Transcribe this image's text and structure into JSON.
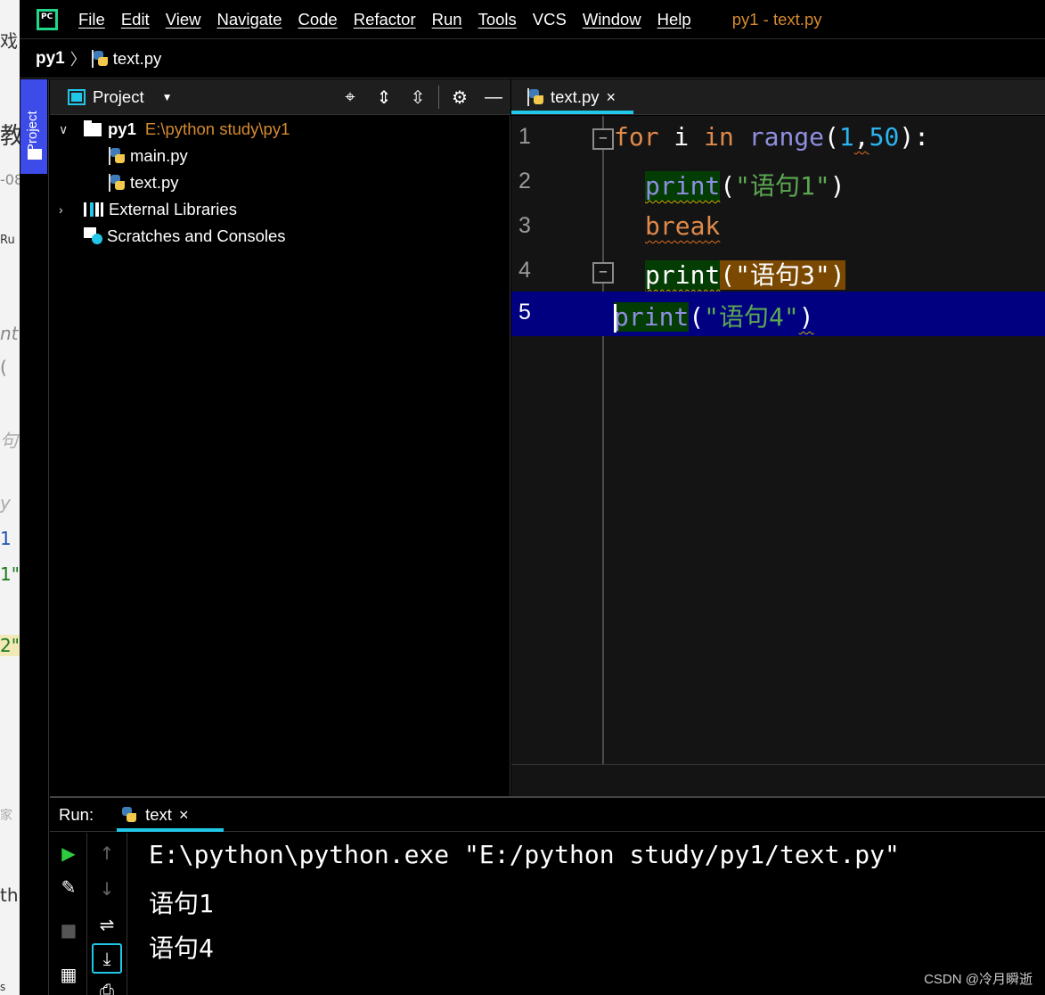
{
  "menubar": {
    "logo": "PC",
    "items": [
      {
        "label": "File",
        "underline": true
      },
      {
        "label": "Edit",
        "underline": true
      },
      {
        "label": "View",
        "underline": true
      },
      {
        "label": "Navigate",
        "underline": true
      },
      {
        "label": "Code",
        "underline": true
      },
      {
        "label": "Refactor",
        "underline": true
      },
      {
        "label": "Run",
        "underline": true
      },
      {
        "label": "Tools",
        "underline": true
      },
      {
        "label": "VCS",
        "underline": false
      },
      {
        "label": "Window",
        "underline": true
      },
      {
        "label": "Help",
        "underline": true
      }
    ],
    "window_title": "py1 - text.py"
  },
  "breadcrumb": {
    "root": "py1",
    "separator": "〉",
    "file": "text.py"
  },
  "tool_strip": {
    "project_tab": "Project"
  },
  "project_panel": {
    "title": "Project",
    "icons": [
      "crosshair-icon",
      "expand-all-icon",
      "collapse-all-icon",
      "gear-icon",
      "minimize-icon"
    ],
    "tree": {
      "root_name": "py1",
      "root_path": "E:\\python study\\py1",
      "files": [
        "main.py",
        "text.py"
      ],
      "external_libraries": "External Libraries",
      "scratches": "Scratches and Consoles"
    }
  },
  "editor": {
    "tab_label": "text.py",
    "tab_close": "×",
    "line_numbers": [
      "1",
      "2",
      "3",
      "4",
      "5"
    ],
    "tokens": {
      "for": "for",
      "i": " i ",
      "in": "in",
      "range": "range",
      "lp": "(",
      "n1": "1",
      "comma": ",",
      "n50": "50",
      "rpc": "):",
      "print": "print",
      "break": "break",
      "s1": "\"语句1\"",
      "s3": "\"语句3\"",
      "s4": "\"语句4\"",
      "rp": ")"
    },
    "current_line": 5
  },
  "run_panel": {
    "label": "Run:",
    "tab_label": "text",
    "tab_close": "×",
    "console": [
      "E:\\python\\python.exe \"E:/python study/py1/text.py\"",
      "语句1",
      "语句4"
    ]
  },
  "background_window": {
    "fragments": [
      "戏",
      "教",
      "-08",
      "Ru",
      "nt",
      "(",
      "句",
      "y",
      "1",
      "1\"",
      "2\"",
      "家",
      "th",
      "s"
    ]
  },
  "watermark": "CSDN @冷月瞬逝",
  "colors": {
    "accent": "#21c7e8",
    "keyword": "#e08a4a",
    "function": "#8f8fe0",
    "number": "#2ab5f0",
    "string": "#5ca852",
    "current_line": "#000080",
    "path": "#d58a2f"
  }
}
